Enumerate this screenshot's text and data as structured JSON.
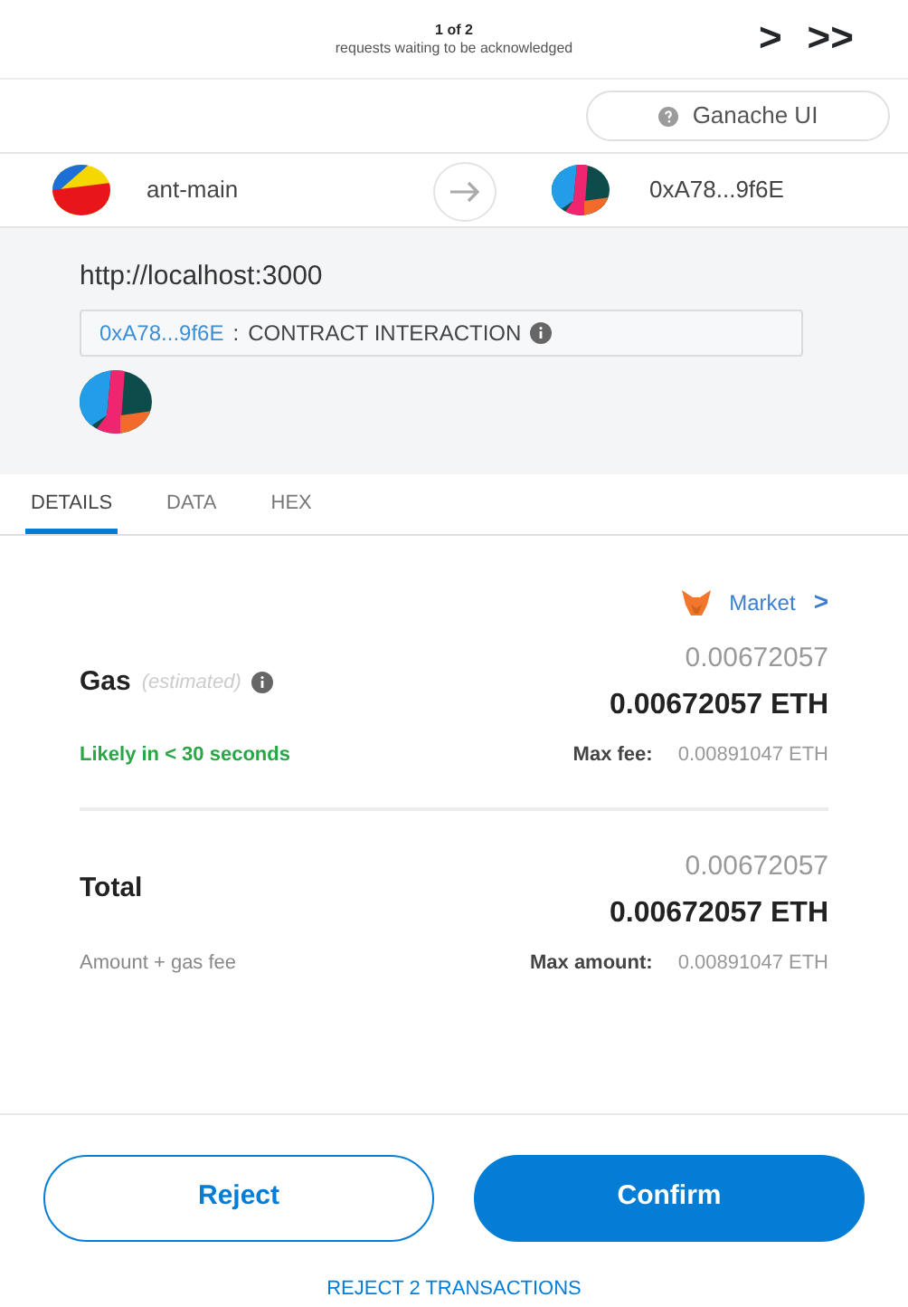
{
  "header": {
    "counter": "1 of 2",
    "subtitle": "requests waiting to be acknowledged",
    "next": ">",
    "last": ">>"
  },
  "network": {
    "label": "Ganache UI"
  },
  "accounts": {
    "from": "ant-main",
    "to": "0xA78...9f6E"
  },
  "origin": "http://localhost:3000",
  "contract": {
    "address": "0xA78...9f6E",
    "separator": ":",
    "method": "CONTRACT INTERACTION"
  },
  "tabs": [
    {
      "label": "DETAILS",
      "selected": true
    },
    {
      "label": "DATA",
      "selected": false
    },
    {
      "label": "HEX",
      "selected": false
    }
  ],
  "market": {
    "label": "Market",
    "chevron": ">"
  },
  "fees": [
    {
      "title": "Gas",
      "note": "(estimated)",
      "info": true,
      "amount": "0.00672057",
      "amount_eth": "0.00672057 ETH",
      "caption": "Likely in < 30 seconds",
      "kind": "timing",
      "max_label": "Max fee:",
      "max_value": "0.00891047 ETH"
    },
    {
      "title": "Total",
      "info": false,
      "amount": "0.00672057",
      "amount_eth": "0.00672057 ETH",
      "caption": "Amount + gas fee",
      "kind": "plain",
      "max_label": "Max amount:",
      "max_value": "0.00891047 ETH"
    }
  ],
  "buttons": [
    {
      "label": "Reject",
      "kind": "secondary"
    },
    {
      "label": "Confirm",
      "kind": "primary"
    }
  ],
  "reject_all": "REJECT 2 TRANSACTIONS"
}
